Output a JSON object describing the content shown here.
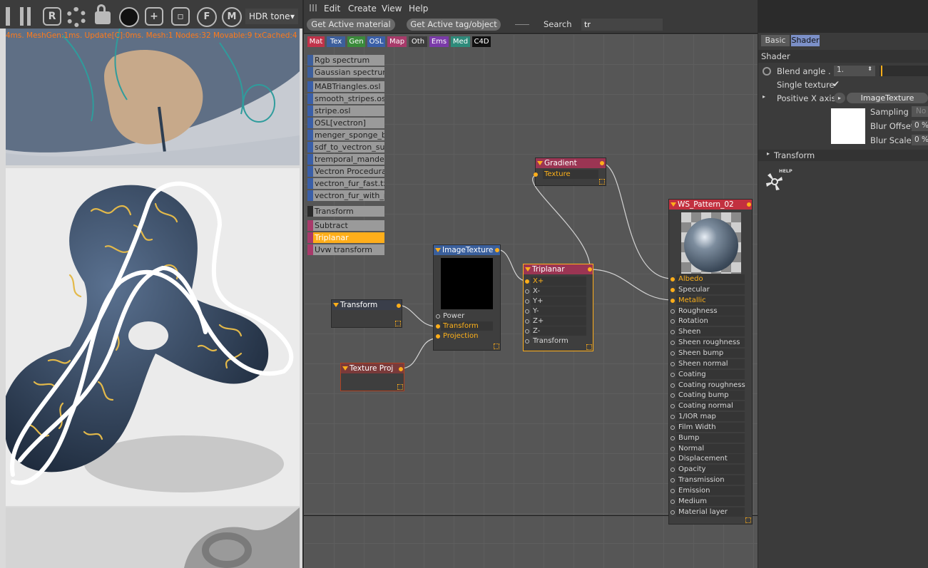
{
  "viewport": {
    "toolbar_icons": [
      "R",
      "F",
      "M"
    ],
    "hdr_tone": "HDR tone",
    "stats": "4ms. MeshGen:1ms. Update[C]:0ms. Mesh:1 Nodes:32 Movable:9 txCached:4"
  },
  "editor": {
    "menu": [
      "Edit",
      "Create",
      "View",
      "Help"
    ],
    "buttons": {
      "get_material": "Get Active material",
      "get_tag": "Get Active tag/object"
    },
    "search_label": "Search",
    "search_value": "tr",
    "categories": [
      {
        "label": "Mat",
        "color": "#c0334a"
      },
      {
        "label": "Tex",
        "color": "#3d5f9c"
      },
      {
        "label": "Gen",
        "color": "#3a8a3a"
      },
      {
        "label": "OSL",
        "color": "#3a5fa8"
      },
      {
        "label": "Map",
        "color": "#a83a6a"
      },
      {
        "label": "Oth",
        "color": "#3c3c3c"
      },
      {
        "label": "Ems",
        "color": "#7a3aa8"
      },
      {
        "label": "Med",
        "color": "#2e8a7a"
      },
      {
        "label": "C4D",
        "color": "#111111"
      }
    ],
    "library": [
      {
        "label": "Rgb spectrum",
        "color": "#3d5f9c"
      },
      {
        "label": "Gaussian spectrum",
        "color": "#3d5f9c"
      },
      {
        "label": "MABTriangles.osl",
        "color": "#3a5fa8"
      },
      {
        "label": "smooth_stripes.osl",
        "color": "#3a5fa8"
      },
      {
        "label": "stripe.osl",
        "color": "#3a5fa8"
      },
      {
        "label": "OSL[vectron]",
        "color": "#3a5fa8"
      },
      {
        "label": "menger_sponge_bo",
        "color": "#3a5fa8"
      },
      {
        "label": "sdf_to_vectron_surfa",
        "color": "#3a5fa8"
      },
      {
        "label": "tremporal_mandelb",
        "color": "#3a5fa8"
      },
      {
        "label": "Vectron Procedural",
        "color": "#3a5fa8"
      },
      {
        "label": "vectron_fur_fast.txt",
        "color": "#3a5fa8"
      },
      {
        "label": "vectron_fur_with_mb",
        "color": "#3a5fa8"
      },
      {
        "label": "Transform",
        "color": "#2a2a2a"
      },
      {
        "label": "Subtract",
        "color": "#a83a6a"
      },
      {
        "label": "Triplanar",
        "color": "#a83a6a",
        "selected": true
      },
      {
        "label": "Uvw transform",
        "color": "#a83a6a"
      }
    ],
    "nodes": {
      "gradient": {
        "title": "Gradient",
        "out": "Texture"
      },
      "transform": {
        "title": "Transform"
      },
      "imagetexture": {
        "title": "ImageTexture",
        "ports": [
          "Power",
          "Transform",
          "Projection"
        ]
      },
      "textureproj": {
        "title": "Texture Proj"
      },
      "triplanar": {
        "title": "Triplanar",
        "ports": [
          "X+",
          "X-",
          "Y+",
          "Y-",
          "Z+",
          "Z-",
          "Transform"
        ]
      },
      "material": {
        "title": "WS_Pattern_02",
        "ports": [
          "Albedo",
          "Specular",
          "Metallic",
          "Roughness",
          "Rotation",
          "Sheen",
          "Sheen roughness",
          "Sheen bump",
          "Sheen normal",
          "Coating",
          "Coating roughness",
          "Coating bump",
          "Coating normal",
          "1/IOR map",
          "Film Width",
          "Bump",
          "Normal",
          "Displacement",
          "Opacity",
          "Transmission",
          "Emission",
          "Medium",
          "Material layer"
        ]
      }
    }
  },
  "panel": {
    "tabs": [
      "Basic",
      "Shader"
    ],
    "section": "Shader",
    "blend_angle_label": "Blend angle . .",
    "blend_angle_value": "1.",
    "single_texture_label": "Single texture",
    "positive_x_label": "Positive X axis",
    "positive_x_value": "ImageTexture",
    "sampling_label": "Sampling",
    "sampling_value": "No",
    "blur_offset_label": "Blur Offset",
    "blur_offset_value": "0 %",
    "blur_scale_label": "Blur Scale",
    "blur_scale_value": "0 %",
    "transform_label": "Transform",
    "help_label": "HELP"
  }
}
